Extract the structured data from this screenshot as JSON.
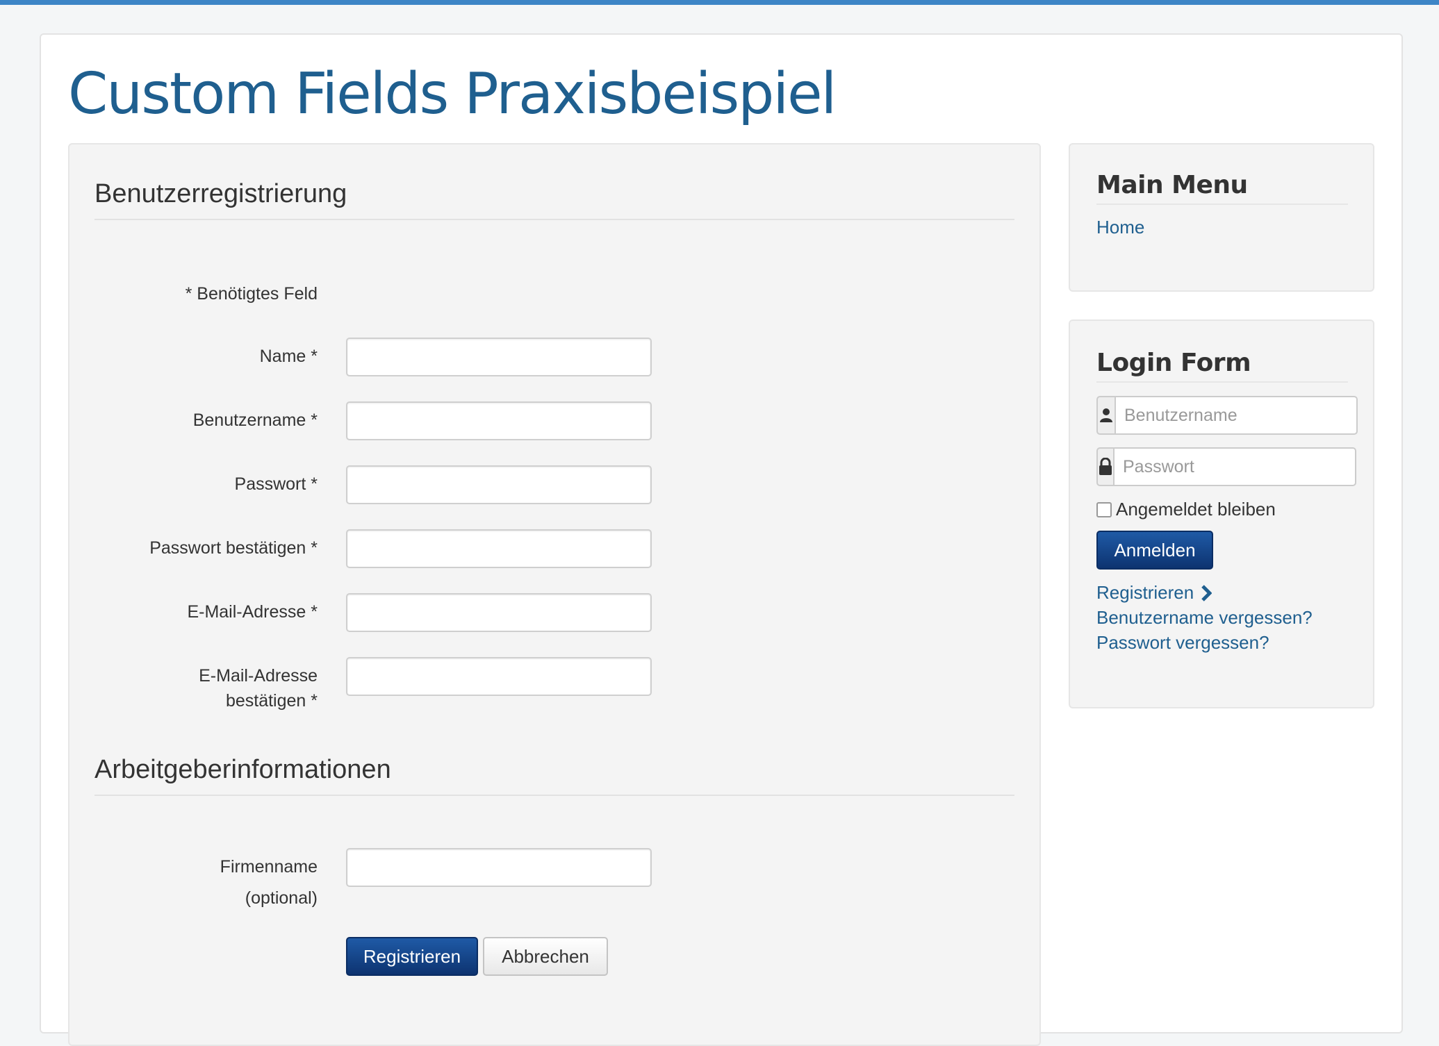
{
  "site": {
    "title": "Custom Fields Praxisbeispiel"
  },
  "registration": {
    "legend": "Benutzerregistrierung",
    "required_note": "* Benötigtes Feld",
    "fields": [
      {
        "label": "Name *"
      },
      {
        "label": "Benutzername *"
      },
      {
        "label": "Passwort *"
      },
      {
        "label": "Passwort bestätigen *"
      },
      {
        "label": "E-Mail-Adresse *"
      },
      {
        "label_line1": "E-Mail-Adresse",
        "label_line2": "bestätigen *"
      }
    ],
    "employer_legend": "Arbeitgeberinformationen",
    "company_label_line1": "Firmenname",
    "company_label_line2": "(optional)",
    "submit_label": "Registrieren",
    "cancel_label": "Abbrechen",
    "primary_color": "#0d3370"
  },
  "sidebar": {
    "main_menu": {
      "title": "Main Menu",
      "items": [
        {
          "label": "Home"
        }
      ]
    },
    "login": {
      "title": "Login Form",
      "username_placeholder": "Benutzername",
      "password_placeholder": "Passwort",
      "remember_label": "Angemeldet bleiben",
      "submit_label": "Anmelden",
      "links": [
        {
          "label": "Registrieren",
          "icon": "chevron-right-icon"
        },
        {
          "label": "Benutzername vergessen?"
        },
        {
          "label": "Passwort vergessen?"
        }
      ]
    }
  },
  "colors": {
    "accent": "#3d85c6",
    "title": "#1f5f8f",
    "link": "#1f5f8f"
  }
}
